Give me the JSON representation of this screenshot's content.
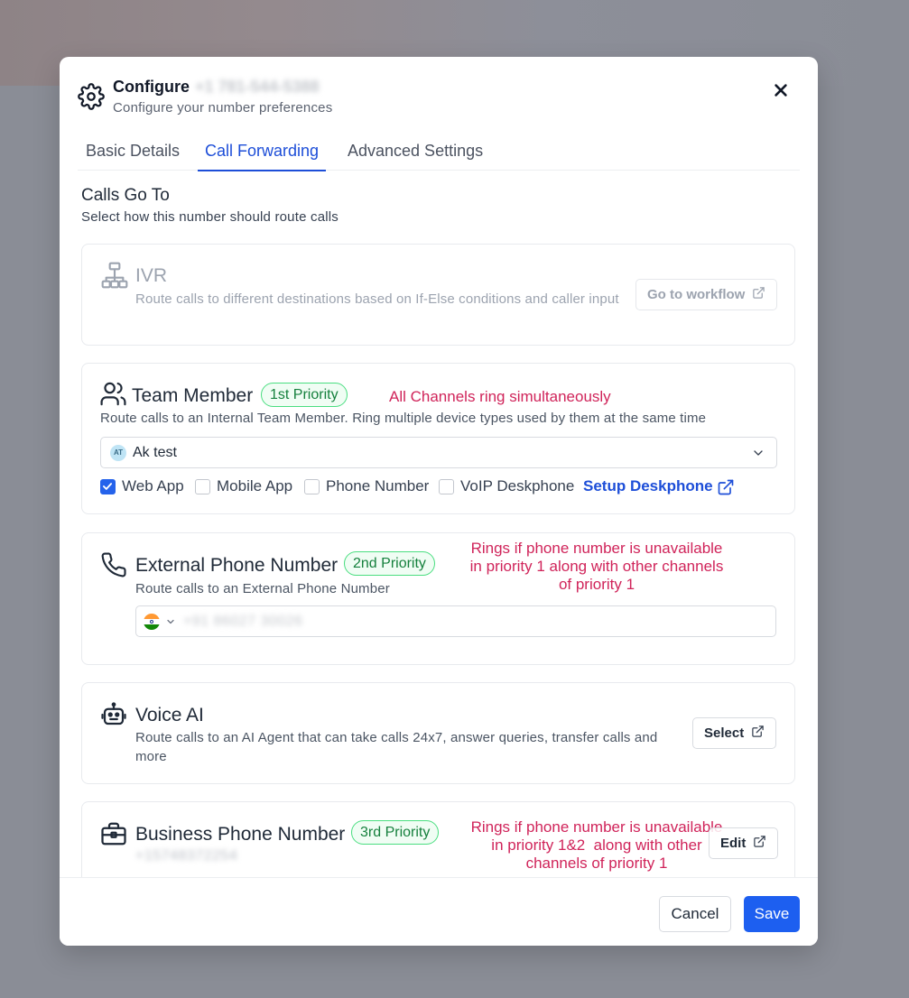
{
  "header": {
    "title": "Configure",
    "number_redacted": "+1 781-544-5388",
    "subtitle": "Configure your number preferences"
  },
  "tabs": [
    {
      "label": "Basic Details",
      "active": false
    },
    {
      "label": "Call Forwarding",
      "active": true
    },
    {
      "label": "Advanced Settings",
      "active": false
    }
  ],
  "calls_go_to": {
    "title": "Calls Go To",
    "subtitle": "Select how this number should route calls"
  },
  "ivr": {
    "title": "IVR",
    "description": "Route calls to different destinations based on If-Else conditions and caller input",
    "button_label": "Go to workflow",
    "disabled": true
  },
  "team_member": {
    "title": "Team Member",
    "priority": "1st Priority",
    "note": "All Channels ring simultaneously",
    "description": "Route calls to an Internal Team Member. Ring multiple device types used by them at the same time",
    "selected_member": {
      "initials": "AT",
      "name": "Ak test"
    },
    "channels": [
      {
        "label": "Web App",
        "checked": true
      },
      {
        "label": "Mobile App",
        "checked": false
      },
      {
        "label": "Phone Number",
        "checked": false
      },
      {
        "label": "VoIP Deskphone",
        "checked": false
      }
    ],
    "setup_link": "Setup Deskphone"
  },
  "external_phone": {
    "title": "External Phone Number",
    "priority": "2nd Priority",
    "note_lines": [
      "Rings if phone number is unavailable",
      "in priority 1 along with other channels",
      "of priority 1"
    ],
    "description": "Route calls to an External Phone Number",
    "phone_value_redacted": "+91 86027 30026"
  },
  "voice_ai": {
    "title": "Voice AI",
    "description": "Route calls to an AI Agent that can take calls 24x7, answer queries, transfer calls and more",
    "button_label": "Select"
  },
  "business_phone": {
    "title": "Business Phone Number",
    "priority": "3rd Priority",
    "number_redacted": "+15748372254",
    "note_lines": [
      "Rings if phone number is unavailable",
      "in priority 1&2  along with other",
      "channels of priority 1"
    ],
    "button_label": "Edit"
  },
  "footer": {
    "cancel_label": "Cancel",
    "save_label": "Save"
  },
  "colors": {
    "accent": "#1d4ed8",
    "save_button": "#1d5ff0",
    "priority_green": "#15803d",
    "annotation_red": "#d0245a"
  }
}
